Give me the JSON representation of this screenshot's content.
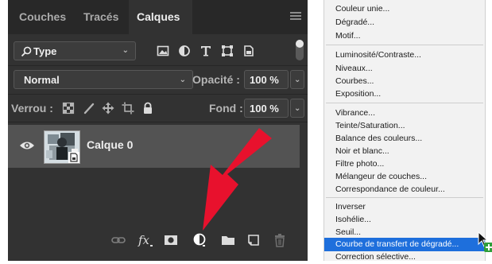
{
  "panel": {
    "tabs": [
      {
        "label": "Couches",
        "active": false
      },
      {
        "label": "Tracés",
        "active": false
      },
      {
        "label": "Calques",
        "active": true
      }
    ],
    "filter": {
      "label": "Type"
    },
    "blend": {
      "mode": "Normal",
      "opacity_label": "Opacité :",
      "opacity_value": "100 %"
    },
    "lock": {
      "label": "Verrou :",
      "fill_label": "Fond :",
      "fill_value": "100 %"
    },
    "layer": {
      "name": "Calque 0",
      "visible": true
    },
    "colors": {
      "panel_bg": "#323232",
      "tabbar_bg": "#282828",
      "selected_layer": "#535353",
      "arrow": "#e8112d"
    }
  },
  "menu": {
    "groups": [
      [
        "Couleur unie...",
        "Dégradé...",
        "Motif..."
      ],
      [
        "Luminosité/Contraste...",
        "Niveaux...",
        "Courbes...",
        "Exposition..."
      ],
      [
        "Vibrance...",
        "Teinte/Saturation...",
        "Balance des couleurs...",
        "Noir et blanc...",
        "Filtre photo...",
        "Mélangeur de couches...",
        "Correspondance de couleur..."
      ],
      [
        "Inverser",
        "Isohélie...",
        "Seuil...",
        "Courbe de transfert de dégradé...",
        "Correction sélective..."
      ]
    ],
    "highlighted": "Courbe de transfert de dégradé...",
    "highlight_color": "#1e6fdc"
  }
}
